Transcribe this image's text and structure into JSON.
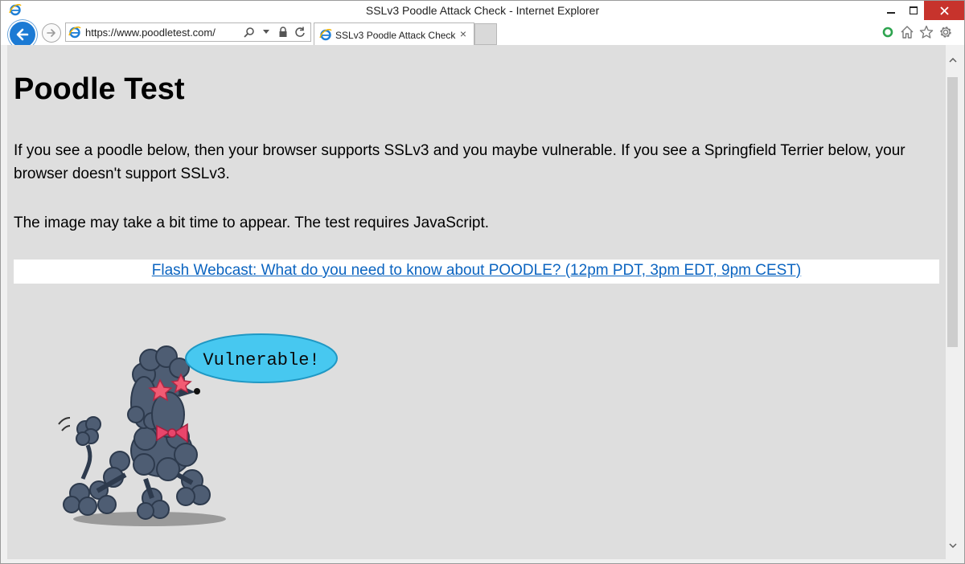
{
  "window": {
    "title": "SSLv3 Poodle Attack Check - Internet Explorer",
    "controls": [
      "minimize-icon",
      "maximize-icon",
      "close-icon"
    ]
  },
  "navbar": {
    "address": "https://www.poodletest.com/",
    "tab": {
      "label": "SSLv3 Poodle Attack Check",
      "close": "×"
    },
    "icons": [
      "back-arrow-icon",
      "forward-arrow-icon",
      "search-icon",
      "lock-icon",
      "refresh-icon",
      "home-icon",
      "star-icon",
      "gear-icon"
    ]
  },
  "page": {
    "title": "Poodle Test",
    "intro": "If you see a poodle below, then your browser supports SSLv3 and you maybe vulnerable. If you see a Springfield Terrier below, your browser doesn't support SSLv3.",
    "note": "The image may take a bit time to appear. The test requires JavaScript.",
    "banner_link": "Flash Webcast: What do you need to know about POODLE? (12pm PDT, 3pm EDT, 9pm CEST)",
    "speech": "Vulnerable!"
  },
  "colors": {
    "accent": "#1b7ad4",
    "link": "#0b64c0",
    "close_button": "#c7332c",
    "speech_bubble": "#47c8f0",
    "poodle": "#4e5d73",
    "bow": "#e9456b"
  }
}
